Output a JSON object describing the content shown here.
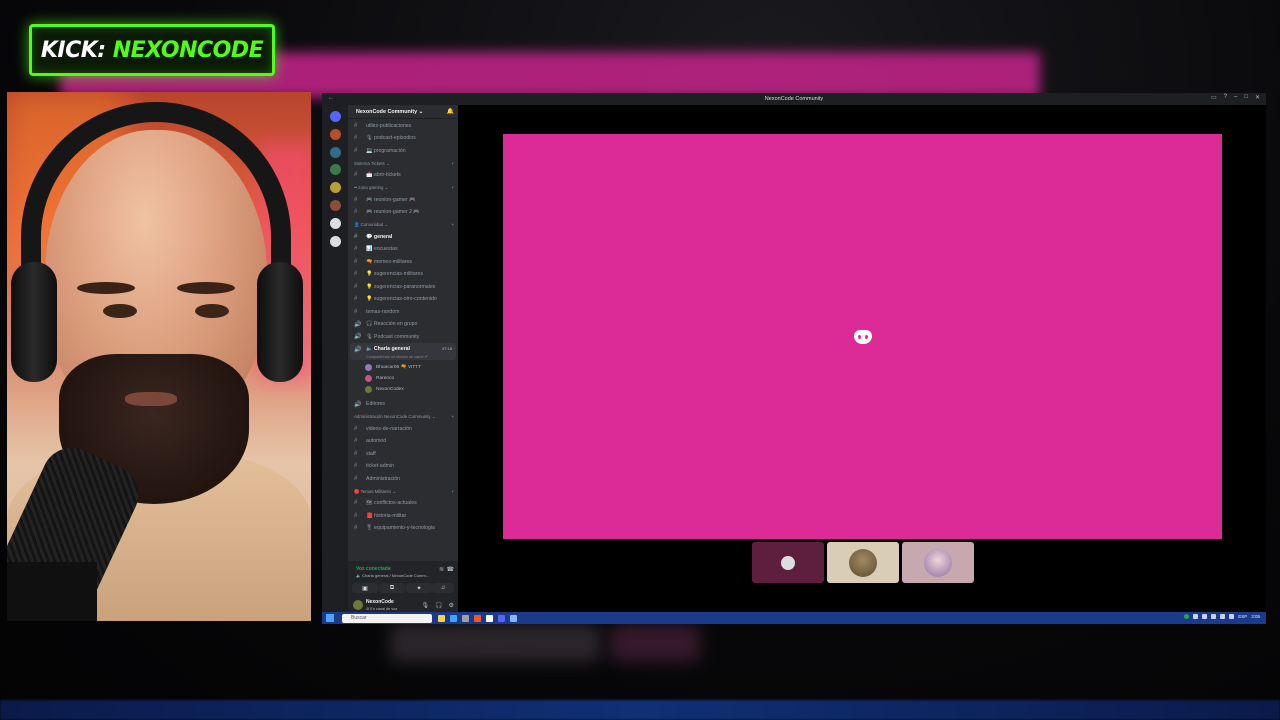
{
  "colors": {
    "kick_green": "#53fc18",
    "share_pink": "#dc2a96",
    "discord_green": "#23a55a",
    "taskbar": "#1b3a8a"
  },
  "kick": {
    "brand": "KICK:",
    "channel": "NEXONCODE"
  },
  "window": {
    "title": "NexonCode Community",
    "back_icon": "back-arrow-icon",
    "controls": [
      "inbox-icon",
      "help-icon",
      "minimize-icon",
      "maximize-icon",
      "close-icon"
    ]
  },
  "server": {
    "name": "NexonCode Community ⌄",
    "channels_top": [
      {
        "icon": "#",
        "label": "utiles-publicaciones"
      },
      {
        "icon": "#",
        "label": "🎙 podcast-episodios"
      },
      {
        "icon": "#",
        "label": "💻 programación"
      }
    ],
    "categories": [
      {
        "label": "Sistema Tickets ⌄",
        "channels": [
          {
            "icon": "#",
            "label": "📩 abrir-tickets"
          }
        ]
      },
      {
        "label": "•• zona gaming ⌄",
        "channels": [
          {
            "icon": "#",
            "label": "🎮 reunion-gamer 🎮"
          },
          {
            "icon": "#",
            "label": "🎮 reunion-gamer 2 🎮"
          }
        ]
      },
      {
        "label": "👤 Comunidad ⌄",
        "channels": [
          {
            "icon": "#",
            "label": "💬 general",
            "active": true
          },
          {
            "icon": "#",
            "label": "📊 encuestas"
          },
          {
            "icon": "#",
            "label": "🔫 memes-militares"
          },
          {
            "icon": "#",
            "label": "💡 sugerencias-militares"
          },
          {
            "icon": "#",
            "label": "💡 sugerencias-paranormales"
          },
          {
            "icon": "#",
            "label": "💡 sugerencias-otro-contenido"
          },
          {
            "icon": "#",
            "label": "temas-random"
          },
          {
            "icon": "🔊",
            "label": "🎧 Reacción en grupo"
          },
          {
            "icon": "🔊",
            "label": "🎙 Podcast community"
          }
        ]
      }
    ],
    "voice_channel": {
      "label": "🔈 Charla general",
      "count": "47:18",
      "sub": "Compartiendo un stream de carné ✐"
    },
    "voice_users": [
      {
        "name": "Bhuacar06 🔫 VITTT",
        "color": "#8f7bb8"
      },
      {
        "name": "Rarenco",
        "color": "#c25586"
      },
      {
        "name": "NexonCodex",
        "color": "#6b7a3a"
      }
    ],
    "after_voice": [
      {
        "icon": "🔊",
        "label": "Editores"
      }
    ],
    "admin_category": {
      "label": "Administración NexonCode Community ⌄",
      "channels": [
        {
          "icon": "#",
          "label": "videos-de-narración"
        },
        {
          "icon": "#",
          "label": "automod"
        },
        {
          "icon": "#",
          "label": "staff"
        },
        {
          "icon": "#",
          "label": "ticket-admin"
        },
        {
          "icon": "#",
          "label": "Administración"
        }
      ]
    },
    "military_category": {
      "label": "🔴 Temas Militares ⌄",
      "channels": [
        {
          "icon": "#",
          "label": "🗺 conflictos-actuales"
        },
        {
          "icon": "#",
          "label": "📕 historia-militar"
        },
        {
          "icon": "#",
          "label": "🎖 equipamiento-y-tecnologia"
        }
      ]
    }
  },
  "voice_panel": {
    "status": "Voz conectada",
    "sub": "🔈 Charla general / NexonCode Comm...",
    "buttons": [
      "camera-icon",
      "screen-share-icon",
      "activities-icon",
      "soundboard-icon"
    ]
  },
  "user_panel": {
    "name": "NexonCode",
    "status": "⊘ En canal de voz"
  },
  "stage_tiles": [
    {
      "kind": "call"
    },
    {
      "kind": "soldier"
    },
    {
      "kind": "anime"
    }
  ],
  "taskbar": {
    "search_placeholder": "Buscar",
    "time": "3:05",
    "lang": "ESP"
  }
}
